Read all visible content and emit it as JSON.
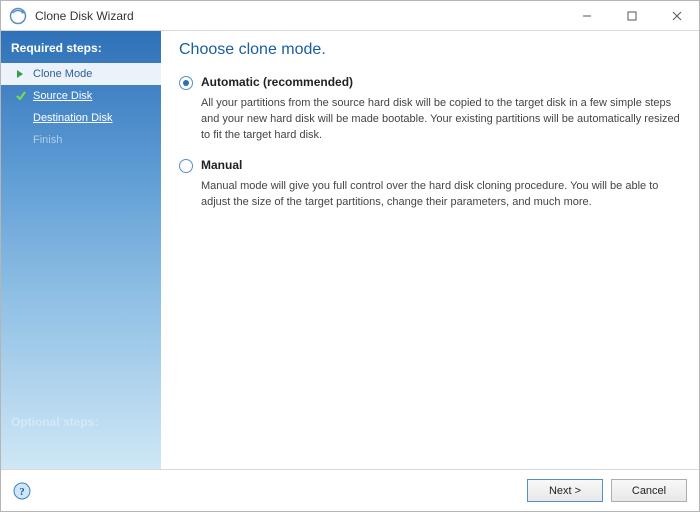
{
  "window": {
    "title": "Clone Disk Wizard"
  },
  "sidebar": {
    "required_label": "Required steps:",
    "optional_label": "Optional steps:",
    "steps": [
      {
        "label": "Clone Mode",
        "state": "active"
      },
      {
        "label": "Source Disk",
        "state": "done"
      },
      {
        "label": "Destination Disk",
        "state": "done"
      },
      {
        "label": "Finish",
        "state": "pending"
      }
    ]
  },
  "main": {
    "heading": "Choose clone mode.",
    "options": [
      {
        "id": "automatic",
        "label": "Automatic (recommended)",
        "selected": true,
        "description": "All your partitions from the source hard disk will be copied to the target disk in a few simple steps and your new hard disk will be made bootable. Your existing partitions will be automatically resized to fit the target hard disk."
      },
      {
        "id": "manual",
        "label": "Manual",
        "selected": false,
        "description": "Manual mode will give you full control over the hard disk cloning procedure. You will be able to adjust the size of the target partitions, change their parameters, and much more."
      }
    ]
  },
  "footer": {
    "next_label": "Next >",
    "cancel_label": "Cancel"
  }
}
